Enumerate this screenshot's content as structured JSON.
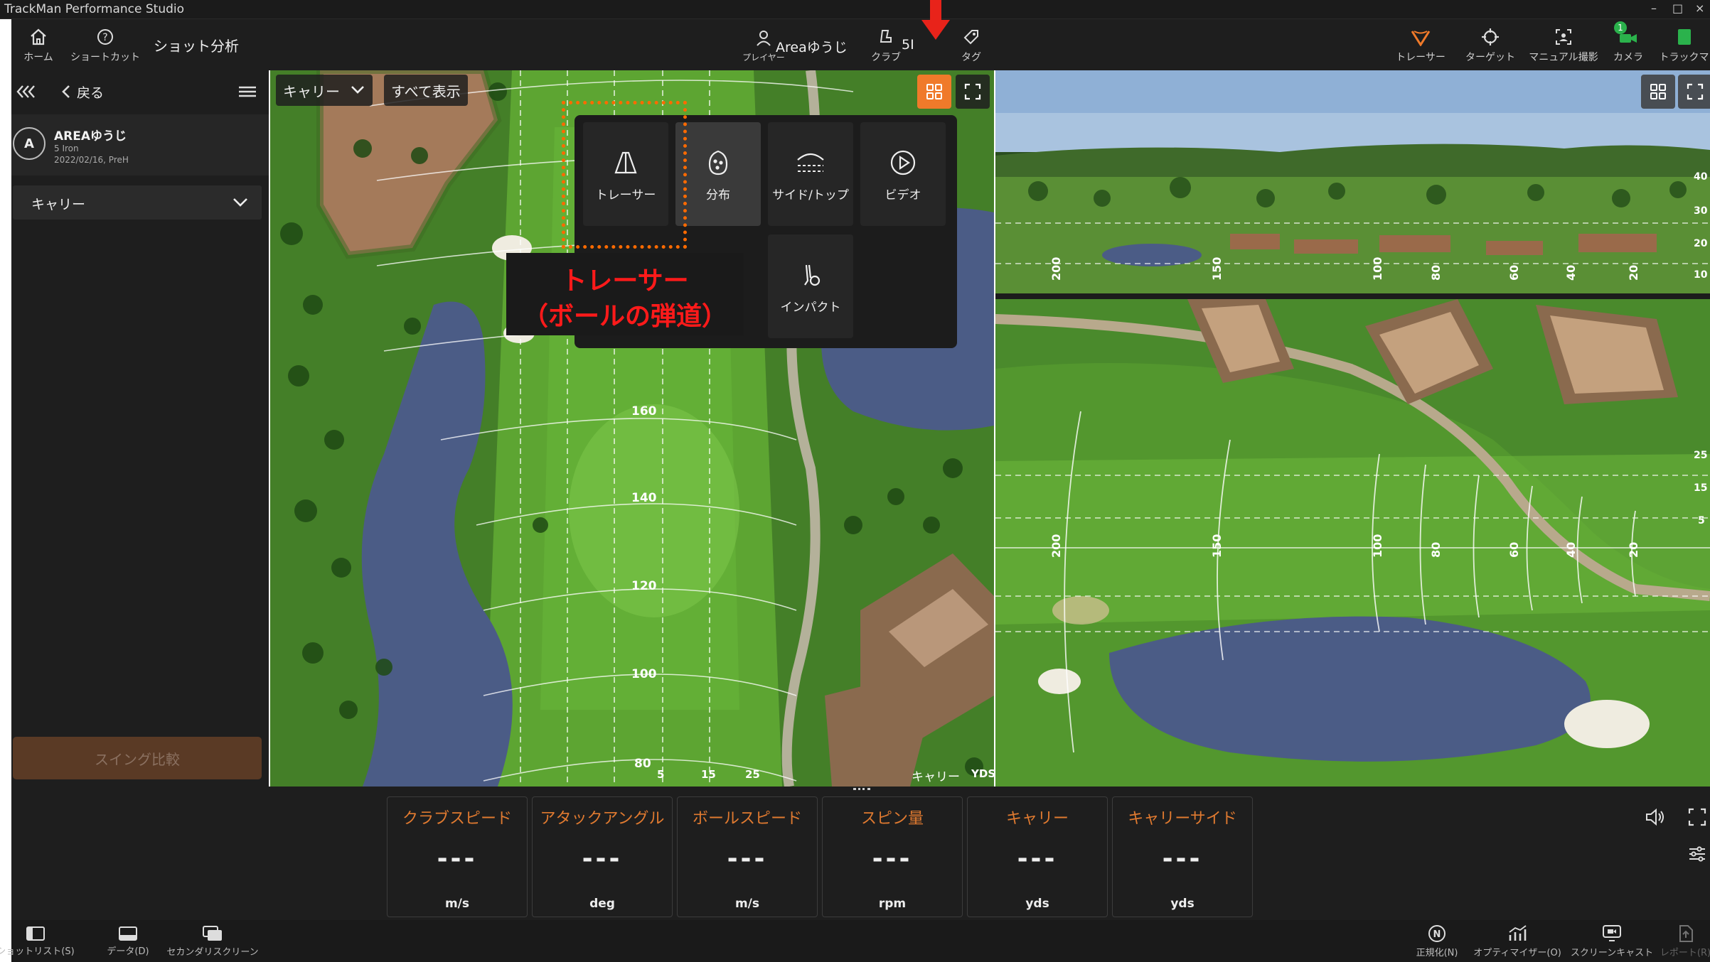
{
  "window": {
    "title": "TrackMan Performance Studio",
    "controls": [
      "–",
      "□",
      "×"
    ]
  },
  "toolbar": {
    "home": "ホーム",
    "shortcuts": "ショートカット",
    "section_title": "ショット分析",
    "player_label": "プレイヤー",
    "player_name": "Areaゆうじ",
    "club_label": "クラブ",
    "club_value": "5I",
    "tag_label": "タグ",
    "tracer": "トレーサー",
    "target": "ターゲット",
    "manual": "マニュアル撮影",
    "camera": "カメラ",
    "camera_badge": "1",
    "trackman": "トラックマ"
  },
  "sidebar": {
    "back": "戻る",
    "player_initial": "A",
    "player_name": "AREAゆうじ",
    "club": "5 Iron",
    "session": "2022/02/16, PreH",
    "select_value": "キャリー",
    "swing_compare": "スイング比較"
  },
  "map": {
    "select_value": "キャリー",
    "show_all": "すべて表示",
    "distances": [
      "160",
      "140",
      "120",
      "100",
      "80"
    ],
    "bottom_ticks": [
      "5",
      "15",
      "25"
    ],
    "corner_label": "キャリー",
    "corner_unit": "YDS"
  },
  "view_menu": {
    "items": [
      "トレーサー",
      "分布",
      "サイド/トップ",
      "ビデオ",
      "インパクト"
    ]
  },
  "annotation": {
    "line1": "トレーサー",
    "line2": "（ボールの弾道）"
  },
  "view3d": {
    "distances_top": [
      "200",
      "150",
      "100",
      "80",
      "60",
      "40",
      "20"
    ],
    "distances_bottom": [
      "200",
      "150",
      "100",
      "80",
      "60",
      "40",
      "20"
    ],
    "side_ticks_top": [
      "40",
      "30",
      "20",
      "10"
    ],
    "side_ticks_bottom": [
      "25",
      "15",
      "5"
    ]
  },
  "metrics": [
    {
      "title": "クラブスピード",
      "value": "---",
      "unit": "m/s"
    },
    {
      "title": "アタックアングル",
      "value": "---",
      "unit": "deg"
    },
    {
      "title": "ボールスピード",
      "value": "---",
      "unit": "m/s"
    },
    {
      "title": "スピン量",
      "value": "---",
      "unit": "rpm"
    },
    {
      "title": "キャリー",
      "value": "---",
      "unit": "yds"
    },
    {
      "title": "キャリーサイド",
      "value": "---",
      "unit": "yds"
    }
  ],
  "statusbar": {
    "shotlist": "ショットリスト(S)",
    "data": "データ(D)",
    "secondary": "セカンダリスクリーン",
    "normalize": "正規化(N)",
    "optimizer": "オプティマイザー(O)",
    "screencast": "スクリーンキャスト",
    "report": "レポート(R)"
  },
  "colors": {
    "accent": "#f07a2a",
    "panel": "#1e1e1e",
    "arrow": "#e8231a",
    "annotation": "#ff1a1a"
  }
}
